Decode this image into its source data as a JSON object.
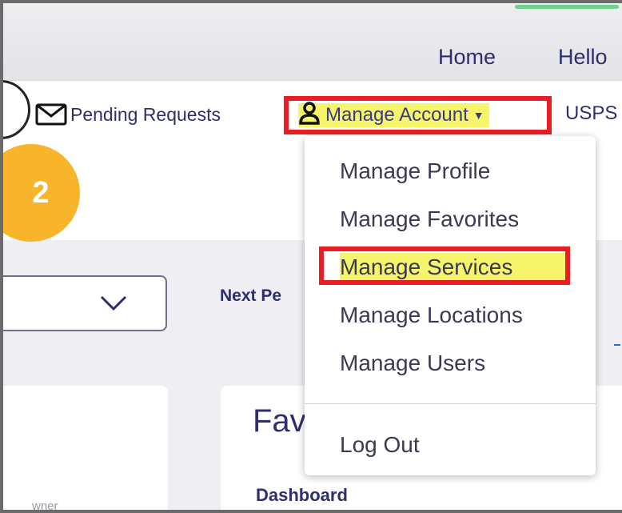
{
  "header": {
    "nav_home": "Home",
    "nav_hello": "Hello"
  },
  "subnav": {
    "pending_requests": "Pending Requests",
    "manage_account": "Manage Account",
    "usps": "USPS"
  },
  "step_badge": "2",
  "dropdown": {
    "items": [
      {
        "label": "Manage Profile"
      },
      {
        "label": "Manage Favorites"
      },
      {
        "label": "Manage Services"
      },
      {
        "label": "Manage Locations"
      },
      {
        "label": "Manage Users"
      }
    ],
    "logout": "Log Out"
  },
  "content": {
    "next_label": "Next Pe",
    "favorites_title": "Fav",
    "dashboard_link": "Dashboard",
    "left_card_text": "wner"
  },
  "colors": {
    "highlight_red": "#ea1c24",
    "highlight_yellow": "#f6f46a",
    "badge_orange": "#f8b52b",
    "text_navy": "#2e2e6e"
  },
  "icons": [
    "mail-icon",
    "user-icon",
    "caret-down-icon",
    "chevron-down-icon"
  ]
}
